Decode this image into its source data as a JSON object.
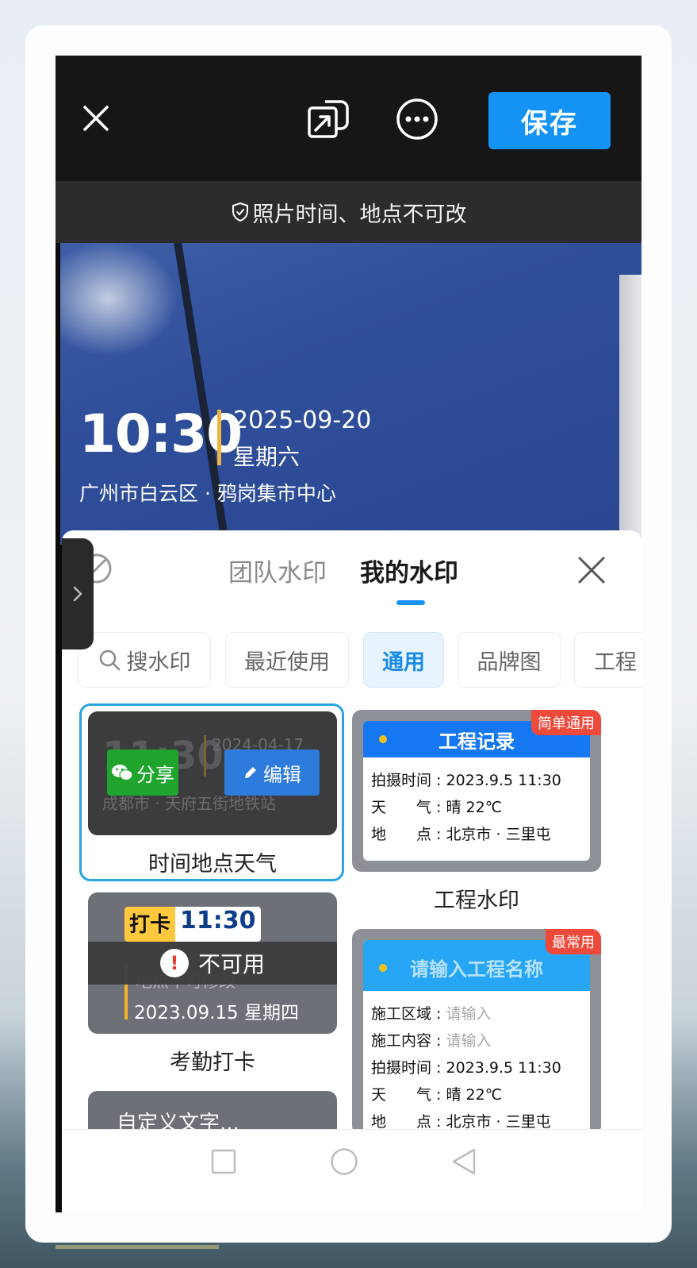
{
  "topbar": {
    "save_label": "保存",
    "icons": [
      "close-icon",
      "share-external-icon",
      "more-icon"
    ]
  },
  "notice": {
    "icon": "shield-check-icon",
    "text": "照片时间、地点不可改"
  },
  "photo_watermark": {
    "time": "10:30",
    "date": "2025-09-20",
    "weekday": "星期六",
    "location": "广州市白云区 · 鸦岗集市中心"
  },
  "panel": {
    "tabs": [
      {
        "label": "团队水印",
        "active": false
      },
      {
        "label": "我的水印",
        "active": true
      }
    ],
    "chips": [
      {
        "label": "搜水印",
        "icon": "search-icon"
      },
      {
        "label": "最近使用"
      },
      {
        "label": "通用",
        "active": true
      },
      {
        "label": "品牌图"
      },
      {
        "label": "工程"
      }
    ],
    "templates": {
      "t1": {
        "name": "时间地点天气",
        "preview_time": "11:30",
        "preview_date": "2024-04-17",
        "preview_loc": "成都市 · 天府五街地铁站",
        "share_label": "分享",
        "edit_label": "编辑"
      },
      "t2": {
        "name": "工程水印",
        "badge": "简单通用",
        "header": "工程记录",
        "rows": [
          "拍摄时间 : 2023.9.5 11:30",
          "天　　气 : 晴 22℃",
          "地　　点 : 北京市 · 三里屯"
        ]
      },
      "t3": {
        "name": "考勤打卡",
        "punch_label": "打卡",
        "punch_time": "11:30",
        "dim_text": "地点不可修改",
        "date_line": "2023.09.15 星期四",
        "unavailable": "不可用"
      },
      "t4": {
        "badge": "最常用",
        "header": "请输入工程名称",
        "rows": [
          {
            "label": "施工区域 : ",
            "value": "请输入",
            "placeholder": true
          },
          {
            "label": "施工内容 : ",
            "value": "请输入",
            "placeholder": true
          },
          {
            "label": "拍摄时间 : ",
            "value": "2023.9.5 11:30",
            "placeholder": false
          },
          {
            "label": "天　　气 : ",
            "value": "晴 22℃",
            "placeholder": false
          },
          {
            "label": "地　　点 : ",
            "value": "北京市 · 三里屯",
            "placeholder": false
          }
        ]
      },
      "t5": {
        "text": "自定义文字..."
      }
    }
  },
  "colors": {
    "accent": "#1593f5",
    "badge": "#ee4a3c",
    "share_green": "#1fa52d"
  }
}
